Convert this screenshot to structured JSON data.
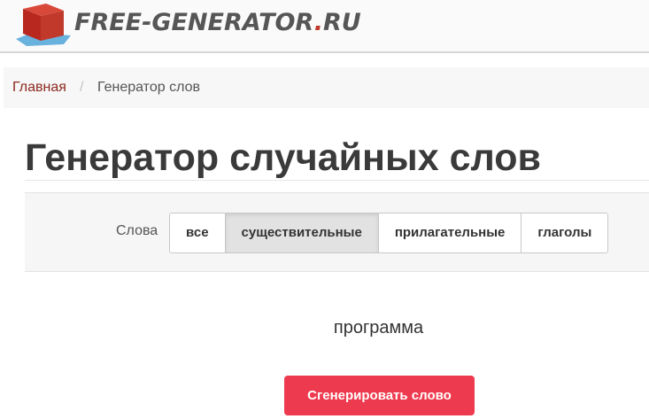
{
  "header": {
    "logo_name": "FREE-GENERATOR",
    "logo_dot": ".",
    "logo_tld": "RU"
  },
  "breadcrumb": {
    "home": "Главная",
    "separator": "/",
    "current": "Генератор слов"
  },
  "page_title": "Генератор случайных слов",
  "filter": {
    "label": "Слова",
    "options": [
      "все",
      "существительные",
      "прилагательные",
      "глаголы"
    ],
    "selected": "существительные"
  },
  "result": {
    "word": "программа"
  },
  "generate_button_label": "Сгенерировать слово",
  "colors": {
    "accent_button": "#ee3a4e",
    "breadcrumb_link": "#8b2a1f",
    "logo_cube": "#c0392b"
  }
}
